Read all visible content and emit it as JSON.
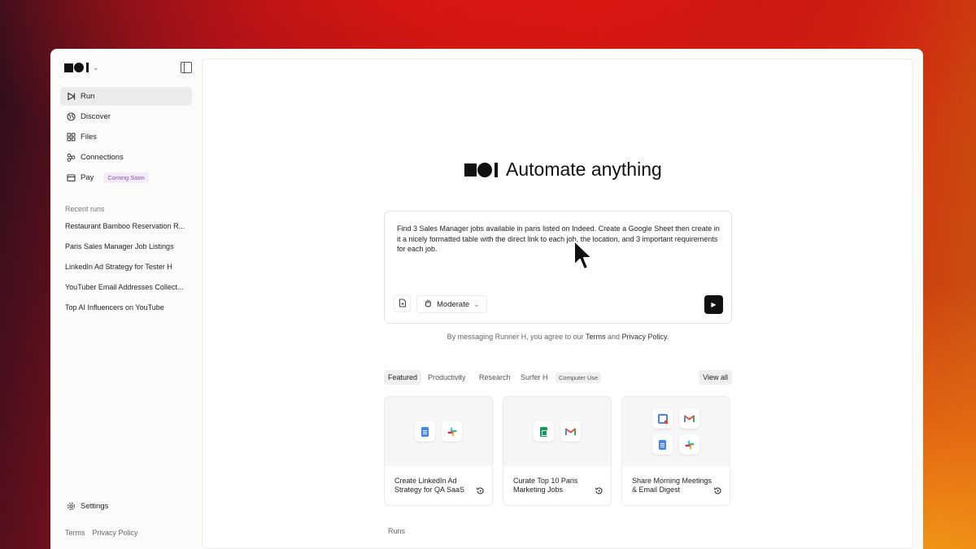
{
  "sidebar": {
    "nav": [
      {
        "label": "Run",
        "icon": "play-outline-icon",
        "active": true
      },
      {
        "label": "Discover",
        "icon": "globe-icon"
      },
      {
        "label": "Files",
        "icon": "grid-icon"
      },
      {
        "label": "Connections",
        "icon": "connections-icon"
      },
      {
        "label": "Pay",
        "icon": "wallet-icon",
        "badge": "Coming Soon"
      }
    ],
    "recent_title": "Recent runs",
    "recent": [
      "Restaurant Bamboo Reservation R...",
      "Paris Sales Manager Job Listings",
      "LinkedIn Ad Strategy for Tester H",
      "YouTuber Email Addresses Collect...",
      "Top AI Influencers on YouTube"
    ],
    "settings_label": "Settings",
    "footer": {
      "terms": "Terms",
      "privacy": "Privacy Policy"
    }
  },
  "main": {
    "hero_title": "Automate anything",
    "prompt": {
      "text": "Find 3 Sales Manager jobs available in paris listed on Indeed. Create a Google Sheet then create in it a nicely formatted table with the direct link to each job, the location, and 3 important requirements for each job.",
      "mode_label": "Moderate"
    },
    "consent": {
      "prefix": "By messaging Runner H, you agree to our ",
      "terms": "Terms",
      "and": " and ",
      "privacy": "Privacy Policy",
      "suffix": "."
    },
    "tabs": [
      "Featured",
      "Productivity",
      "Research",
      "Surfer H"
    ],
    "tab_tag": "Computer Use",
    "view_all": "View all",
    "cards": [
      {
        "title": "Create LinkedIn Ad Strategy for QA SaaS"
      },
      {
        "title": "Curate Top 10 Paris Marketing Jobs"
      },
      {
        "title": "Share Morning Meetings & Email Digest"
      }
    ],
    "runs_label": "Runs"
  },
  "colors": {
    "badge_text": "#8b4ab8",
    "send_button": "#111111"
  }
}
